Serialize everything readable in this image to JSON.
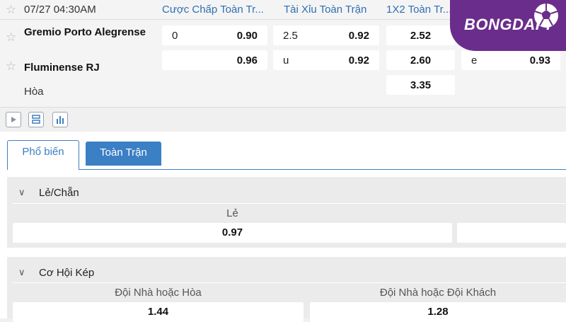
{
  "match": {
    "datetime": "07/27 04:30AM",
    "home_team": "Gremio Porto Alegrense",
    "away_team": "Fluminense RJ",
    "draw_label": "Hòa"
  },
  "columns": {
    "handicap": "Cược Chấp Toàn Tr...",
    "overunder": "Tài Xỉu Toàn Trận",
    "onextwo": "1X2 Toàn Tr..."
  },
  "odds": {
    "handicap_home_line": "0",
    "handicap_home_odds": "0.90",
    "handicap_away_odds": "0.96",
    "ou_over_line": "2.5",
    "ou_over_odds": "0.92",
    "ou_under_label": "u",
    "ou_under_odds": "0.92",
    "x12_home": "2.52",
    "x12_away": "2.60",
    "x12_draw": "3.35",
    "extra_label": "e",
    "extra_odds": "0.93"
  },
  "logo": {
    "text": "BONGDAPI",
    "color": "#6a2d8c"
  },
  "icons": [
    "play-icon",
    "list-icon",
    "stats-icon",
    "star-icon",
    "chevron-down-icon",
    "soccer-ball-icon"
  ],
  "tabs": [
    {
      "label": "Phổ biến",
      "active": true
    },
    {
      "label": "Toàn Trận",
      "active": false
    }
  ],
  "sections": {
    "odd_even": {
      "title": "Lẻ/Chẵn",
      "options": [
        {
          "label": "Lẻ",
          "value": "0.97"
        }
      ]
    },
    "double_chance": {
      "title": "Cơ Hội Kép",
      "options": [
        {
          "label": "Đội Nhà hoặc Hòa",
          "value": "1.44"
        },
        {
          "label": "Đội Nhà hoặc Đội Khách",
          "value": "1.28"
        }
      ]
    }
  },
  "colors": {
    "accent_blue": "#3b7fc4",
    "header_blue": "#2f6fb0"
  }
}
